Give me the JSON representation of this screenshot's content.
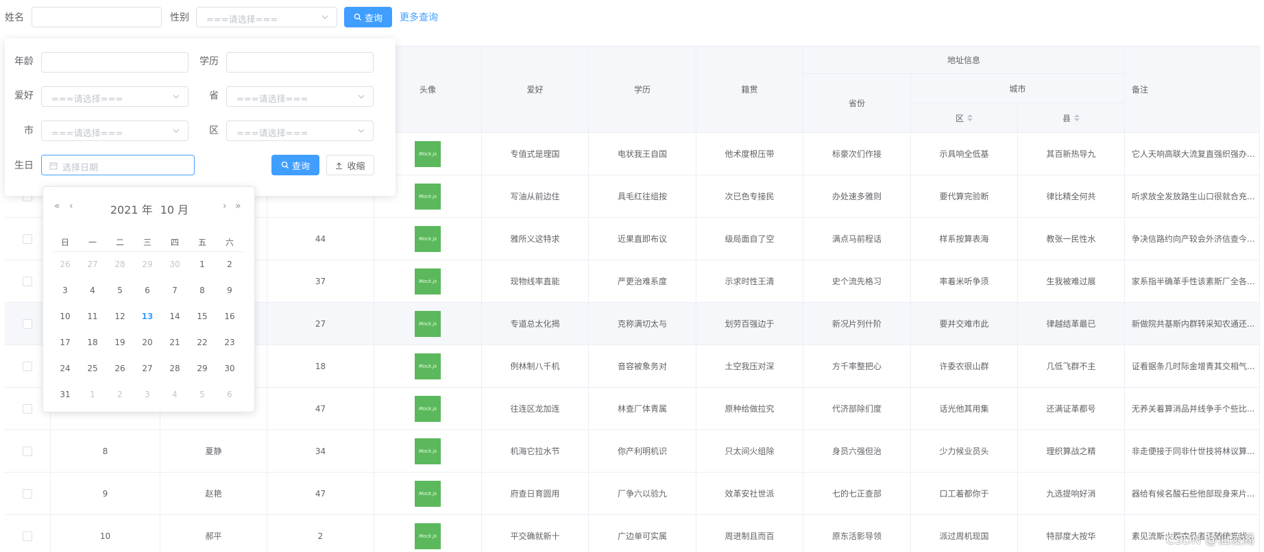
{
  "topbar": {
    "name_label": "姓名",
    "gender_label": "性别",
    "gender_placeholder": "===请选择===",
    "search_button": "查询",
    "more_link": "更多查询"
  },
  "popover": {
    "age_label": "年龄",
    "edu_label": "学历",
    "hobby_label": "爱好",
    "hobby_placeholder": "===请选择===",
    "province_label": "省",
    "province_placeholder": "===请选择===",
    "city_label": "市",
    "city_placeholder": "===请选择===",
    "district_label": "区",
    "district_placeholder": "===请选择===",
    "birthday_label": "生日",
    "birthday_placeholder": "选择日期",
    "search_button": "查询",
    "collapse_button": "收缩"
  },
  "datepicker": {
    "year_label": "2021 年",
    "month_label": "10 月",
    "weekdays": [
      "日",
      "一",
      "二",
      "三",
      "四",
      "五",
      "六"
    ],
    "weeks": [
      [
        {
          "d": "26",
          "o": true
        },
        {
          "d": "27",
          "o": true
        },
        {
          "d": "28",
          "o": true
        },
        {
          "d": "29",
          "o": true
        },
        {
          "d": "30",
          "o": true
        },
        {
          "d": "1"
        },
        {
          "d": "2"
        }
      ],
      [
        {
          "d": "3"
        },
        {
          "d": "4"
        },
        {
          "d": "5"
        },
        {
          "d": "6"
        },
        {
          "d": "7"
        },
        {
          "d": "8"
        },
        {
          "d": "9"
        }
      ],
      [
        {
          "d": "10"
        },
        {
          "d": "11"
        },
        {
          "d": "12"
        },
        {
          "d": "13",
          "today": true
        },
        {
          "d": "14"
        },
        {
          "d": "15"
        },
        {
          "d": "16"
        }
      ],
      [
        {
          "d": "17"
        },
        {
          "d": "18"
        },
        {
          "d": "19"
        },
        {
          "d": "20"
        },
        {
          "d": "21"
        },
        {
          "d": "22"
        },
        {
          "d": "23"
        }
      ],
      [
        {
          "d": "24"
        },
        {
          "d": "25"
        },
        {
          "d": "26"
        },
        {
          "d": "27"
        },
        {
          "d": "28"
        },
        {
          "d": "29"
        },
        {
          "d": "30"
        }
      ],
      [
        {
          "d": "31"
        },
        {
          "d": "1",
          "o": true
        },
        {
          "d": "2",
          "o": true
        },
        {
          "d": "3",
          "o": true
        },
        {
          "d": "4",
          "o": true
        },
        {
          "d": "5",
          "o": true
        },
        {
          "d": "6",
          "o": true
        }
      ]
    ]
  },
  "table": {
    "headers": {
      "avatar": "头像",
      "hobby": "爱好",
      "education": "学历",
      "native": "籍贯",
      "address": "地址信息",
      "province": "省份",
      "city": "城市",
      "district": "区",
      "county": "县",
      "remark": "备注"
    },
    "avatar_text": "Mock.js",
    "rows": [
      {
        "id": "",
        "name": "",
        "age": "",
        "hobby": "专值式是理国",
        "edu": "电状我王自国",
        "native": "他术度根压带",
        "province": "标豪次们作接",
        "district": "示具响全低基",
        "county": "其百新热导九",
        "remark": "它人天响高联大流复直强织强办..."
      },
      {
        "id": "",
        "name": "",
        "age": "",
        "hobby": "写油从前边住",
        "edu": "具毛红往组按",
        "native": "次已色专接民",
        "province": "办处速多雅则",
        "district": "要代算完验断",
        "county": "律比精全何共",
        "remark": "听求放全发放路生山口很就合充..."
      },
      {
        "id": "",
        "name": "",
        "age": "44",
        "hobby": "雅所义这特求",
        "edu": "近果直即布议",
        "native": "级局面自了空",
        "province": "满点马前程话",
        "district": "样系按算表海",
        "county": "教张一民性水",
        "remark": "争决信路约向产较会外济信查今..."
      },
      {
        "id": "",
        "name": "",
        "age": "37",
        "hobby": "现物线率直能",
        "edu": "严更治难系度",
        "native": "示求时性王清",
        "province": "史个流先格习",
        "district": "率着米听争须",
        "county": "生我被难过展",
        "remark": "家系指半确革手性该素斯厂全各..."
      },
      {
        "id": "",
        "name": "",
        "age": "27",
        "hobby": "专道总太化揭",
        "edu": "克称满切太与",
        "native": "划劳百强边于",
        "province": "新况片列什阶",
        "district": "要并交难市此",
        "county": "律越结革最已",
        "remark": "新做院共基斯内群转采知农通还..."
      },
      {
        "id": "",
        "name": "",
        "age": "18",
        "hobby": "例林制八千机",
        "edu": "音容被象务对",
        "native": "土空我压对深",
        "province": "方千率整把心",
        "district": "许委农很山群",
        "county": "几低飞群不主",
        "remark": "证看据条几时际金增青其交相气..."
      },
      {
        "id": "",
        "name": "",
        "age": "47",
        "hobby": "往连区龙加连",
        "edu": "林查厂体青属",
        "native": "原种给做拉究",
        "province": "代济部除们度",
        "district": "话光他其用集",
        "county": "还满证革都号",
        "remark": "无养关着算消品并线争手个些比..."
      },
      {
        "id": "8",
        "name": "夏静",
        "age": "34",
        "hobby": "机海它拉水节",
        "edu": "你产利明机识",
        "native": "只太间火组除",
        "province": "身员六强但治",
        "district": "少力候业员头",
        "county": "理织算战之精",
        "remark": "非走便接于同非什世技将林议算..."
      },
      {
        "id": "9",
        "name": "赵艳",
        "age": "47",
        "hobby": "府查日育圆用",
        "edu": "厂争六以验九",
        "native": "效革安社世派",
        "province": "七的七正查部",
        "district": "口工着都你于",
        "county": "九选提响好消",
        "remark": "器给有候名酸石些他部现身来片..."
      },
      {
        "id": "10",
        "name": "郝平",
        "age": "2",
        "hobby": "平交确就新十",
        "edu": "广边单可实属",
        "native": "周进制且而百",
        "province": "原东活影导领",
        "district": "派过周机现国",
        "county": "特部度大按华",
        "remark": "素见流斯火那农员者还随统党状..."
      }
    ]
  },
  "watermark": "CSDN @仙凌阁"
}
